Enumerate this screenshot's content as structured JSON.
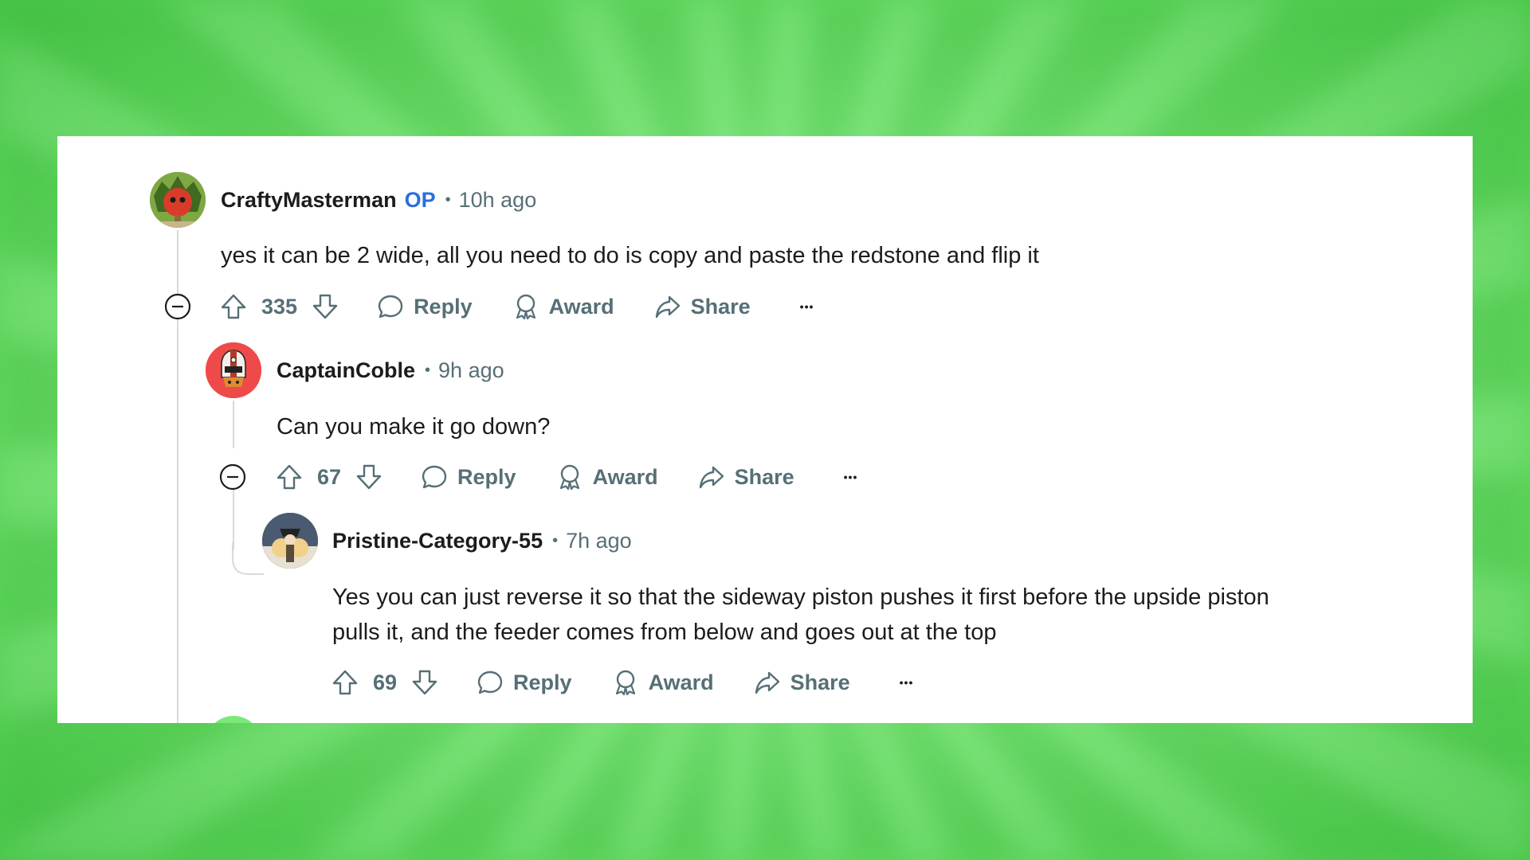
{
  "comments": [
    {
      "author": "CraftyMasterman",
      "op_badge": "OP",
      "separator": "•",
      "time": "10h ago",
      "body": "yes it can be 2 wide, all you need to do is copy and paste the redstone and flip it",
      "votes": "335",
      "reply": "Reply",
      "award": "Award",
      "share": "Share",
      "more": "•••"
    },
    {
      "author": "CaptainCoble",
      "separator": "•",
      "time": "9h ago",
      "body": "Can you make it go down?",
      "votes": "67",
      "reply": "Reply",
      "award": "Award",
      "share": "Share",
      "more": "•••"
    },
    {
      "author": "Pristine-Category-55",
      "separator": "•",
      "time": "7h ago",
      "body_line1": "Yes you can just reverse it so that the sideway piston pushes it first before the upside piston",
      "body_line2": "pulls it, and the feeder comes from below and goes out at the top",
      "votes": "69",
      "reply": "Reply",
      "award": "Award",
      "share": "Share",
      "more": "•••"
    }
  ],
  "colors": {
    "background_green": "#7be879",
    "op_blue": "#2a6fdb",
    "meta_gray": "#576f76",
    "text": "#1c1c1c",
    "thread_line": "#d7dadc",
    "avatar_red": "#ee4a4a"
  },
  "icons": [
    "collapse-icon",
    "upvote-icon",
    "downvote-icon",
    "reply-icon",
    "award-icon",
    "share-icon",
    "more-icon"
  ]
}
